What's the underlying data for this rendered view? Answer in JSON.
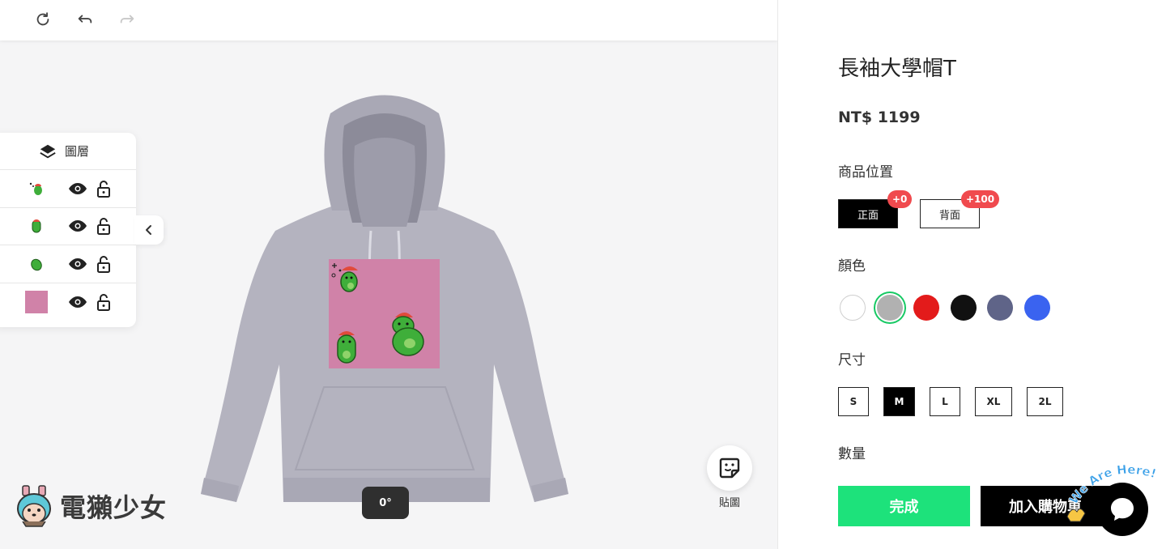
{
  "toolbar": {
    "reset_icon": "reset-icon",
    "undo_icon": "undo-icon",
    "redo_icon": "redo-icon"
  },
  "layers": {
    "title": "圖層",
    "items": [
      {
        "thumb": "sticker-small-green"
      },
      {
        "thumb": "sticker-green-standing"
      },
      {
        "thumb": "sticker-green-lying"
      },
      {
        "thumb": "pink-background",
        "color": "#d082a8"
      }
    ]
  },
  "canvas": {
    "rotation": "0°",
    "print_color": "#d082a8",
    "hoodie_color": "#b4b3bf"
  },
  "sticker_button": {
    "label": "貼圖"
  },
  "logo": {
    "text": "電獺少女"
  },
  "product": {
    "title": "長袖大學帽T",
    "price": "NT$ 1199",
    "position_label": "商品位置",
    "positions": [
      {
        "label": "正面",
        "badge": "+0",
        "active": true
      },
      {
        "label": "背面",
        "badge": "+100",
        "active": false
      }
    ],
    "color_label": "顏色",
    "colors": [
      "#ffffff",
      "#b1b1b1",
      "#e31b1b",
      "#111111",
      "#5f6488",
      "#3a63f0"
    ],
    "selected_color_index": 1,
    "size_label": "尺寸",
    "sizes": [
      "S",
      "M",
      "L",
      "XL",
      "2L"
    ],
    "selected_size": "M",
    "quantity_label": "數量",
    "done_label": "完成",
    "cart_label": "加入購物車"
  },
  "chat": {
    "bubble_text": "We Are Here!"
  }
}
